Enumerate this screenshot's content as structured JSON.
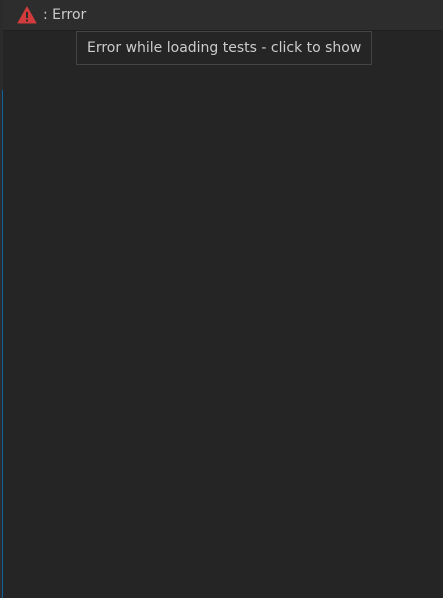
{
  "status": {
    "icon": "warning-triangle-icon",
    "label": ": Error"
  },
  "tooltip": {
    "text": "Error while loading tests - click to show"
  },
  "colors": {
    "background": "#252526",
    "text": "#cccccc",
    "warning": "#f14c4c",
    "focus_border": "#0e639c"
  }
}
